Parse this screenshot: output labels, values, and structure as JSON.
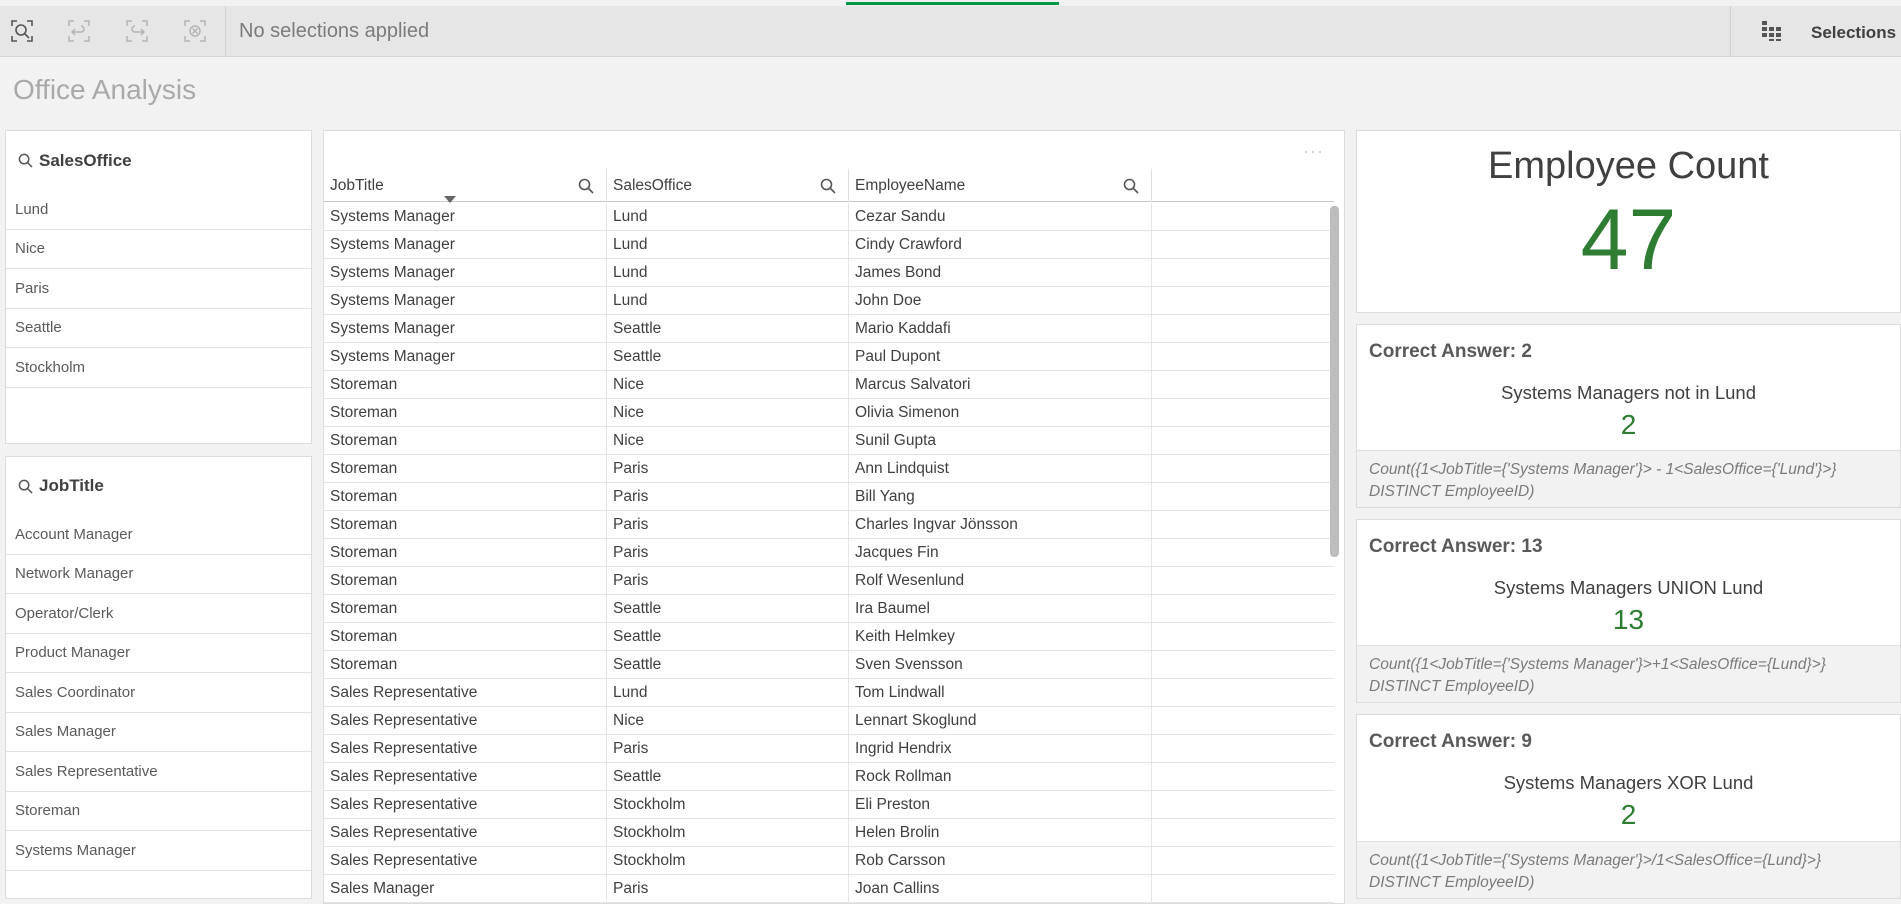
{
  "toolbar": {
    "status_text": "No selections applied",
    "selections_label": "Selections",
    "accent_color": "#009845"
  },
  "sheet": {
    "title": "Office Analysis"
  },
  "filters": {
    "sales_office": {
      "title": "SalesOffice",
      "items": [
        "Lund",
        "Nice",
        "Paris",
        "Seattle",
        "Stockholm"
      ]
    },
    "job_title": {
      "title": "JobTitle",
      "items": [
        "Account Manager",
        "Network Manager",
        "Operator/Clerk",
        "Product Manager",
        "Sales Coordinator",
        "Sales Manager",
        "Sales Representative",
        "Storeman",
        "Systems Manager"
      ]
    }
  },
  "table": {
    "columns": [
      "JobTitle",
      "SalesOffice",
      "EmployeeName"
    ],
    "rows": [
      [
        "Systems Manager",
        "Lund",
        "Cezar Sandu"
      ],
      [
        "Systems Manager",
        "Lund",
        "Cindy Crawford"
      ],
      [
        "Systems Manager",
        "Lund",
        "James Bond"
      ],
      [
        "Systems Manager",
        "Lund",
        "John Doe"
      ],
      [
        "Systems Manager",
        "Seattle",
        "Mario Kaddafi"
      ],
      [
        "Systems Manager",
        "Seattle",
        "Paul Dupont"
      ],
      [
        "Storeman",
        "Nice",
        "Marcus Salvatori"
      ],
      [
        "Storeman",
        "Nice",
        "Olivia Simenon"
      ],
      [
        "Storeman",
        "Nice",
        "Sunil Gupta"
      ],
      [
        "Storeman",
        "Paris",
        "Ann Lindquist"
      ],
      [
        "Storeman",
        "Paris",
        "Bill Yang"
      ],
      [
        "Storeman",
        "Paris",
        "Charles Ingvar Jönsson"
      ],
      [
        "Storeman",
        "Paris",
        "Jacques Fin"
      ],
      [
        "Storeman",
        "Paris",
        "Rolf Wesenlund"
      ],
      [
        "Storeman",
        "Seattle",
        "Ira Baumel"
      ],
      [
        "Storeman",
        "Seattle",
        "Keith Helmkey"
      ],
      [
        "Storeman",
        "Seattle",
        "Sven Svensson"
      ],
      [
        "Sales Representative",
        "Lund",
        "Tom Lindwall"
      ],
      [
        "Sales Representative",
        "Nice",
        "Lennart Skoglund"
      ],
      [
        "Sales Representative",
        "Paris",
        "Ingrid Hendrix"
      ],
      [
        "Sales Representative",
        "Seattle",
        "Rock Rollman"
      ],
      [
        "Sales Representative",
        "Stockholm",
        "Eli Preston"
      ],
      [
        "Sales Representative",
        "Stockholm",
        "Helen Brolin"
      ],
      [
        "Sales Representative",
        "Stockholm",
        "Rob Carsson"
      ],
      [
        "Sales Manager",
        "Paris",
        "Joan Callins"
      ]
    ]
  },
  "kpi": {
    "title": "Employee Count",
    "value": "47"
  },
  "answers": [
    {
      "title": "Correct Answer: 2",
      "label": "Systems Managers not in Lund",
      "value": "2",
      "formula_line1": "Count({1<JobTitle={'Systems Manager'}> - 1<SalesOffice={'Lund'}>}",
      "formula_line2": "DISTINCT EmployeeID)"
    },
    {
      "title": "Correct Answer: 13",
      "label": "Systems Managers UNION Lund",
      "value": "13",
      "formula_line1": "Count({1<JobTitle={'Systems Manager'}>+1<SalesOffice={Lund}>}",
      "formula_line2": "DISTINCT EmployeeID)"
    },
    {
      "title": "Correct Answer: 9",
      "label": "Systems Managers XOR Lund",
      "value": "2",
      "formula_line1": "Count({1<JobTitle={'Systems Manager'}>/1<SalesOffice={Lund}>}",
      "formula_line2": "DISTINCT EmployeeID)"
    }
  ]
}
